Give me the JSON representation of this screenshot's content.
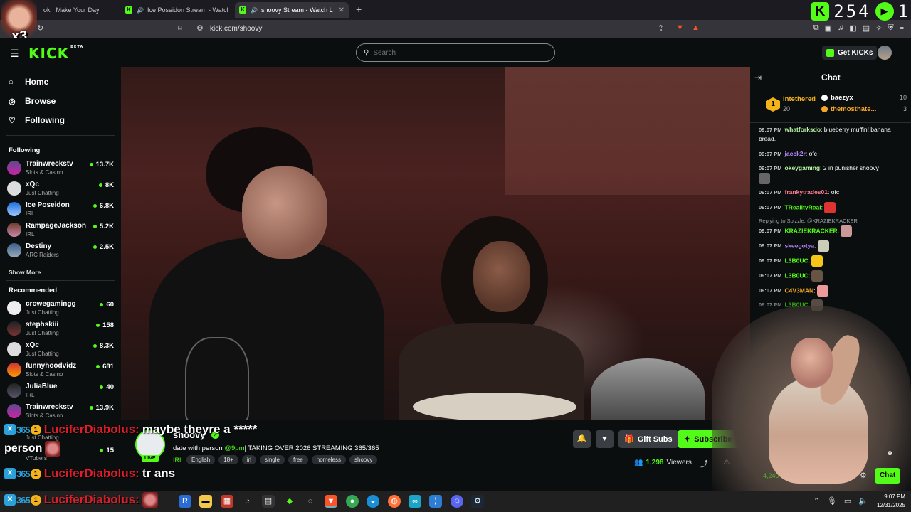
{
  "browser": {
    "tabs": [
      {
        "title": "ok · Make Your Day",
        "active": false
      },
      {
        "title": "Ice Poseidon Stream - Watch Live",
        "active": false
      },
      {
        "title": "shoovy Stream - Watch Live o",
        "active": true
      }
    ],
    "url": "kick.com/shoovy"
  },
  "overlay": {
    "counter": "254",
    "counter2": "1",
    "multiplier": "x3"
  },
  "header": {
    "logo": "KICK",
    "logo_beta": "BETA",
    "search_placeholder": "Search",
    "get_kicks": "Get KICKs"
  },
  "sidebar": {
    "nav": [
      {
        "label": "Home",
        "icon": "home-icon"
      },
      {
        "label": "Browse",
        "icon": "compass-icon"
      },
      {
        "label": "Following",
        "icon": "heart-icon"
      }
    ],
    "following_heading": "Following",
    "following": [
      {
        "name": "Trainwreckstv",
        "category": "Slots & Casino",
        "viewers": "13.7K"
      },
      {
        "name": "xQc",
        "category": "Just Chatting",
        "viewers": "8K"
      },
      {
        "name": "Ice Poseidon",
        "category": "IRL",
        "viewers": "6.8K"
      },
      {
        "name": "RampageJackson",
        "category": "IRL",
        "viewers": "5.2K"
      },
      {
        "name": "Destiny",
        "category": "ARC Raiders",
        "viewers": "2.5K"
      }
    ],
    "show_more": "Show More",
    "recommended_heading": "Recommended",
    "recommended": [
      {
        "name": "crowegamingg",
        "category": "Just Chatting",
        "viewers": "60"
      },
      {
        "name": "stephskiii",
        "category": "Just Chatting",
        "viewers": "158"
      },
      {
        "name": "xQc",
        "category": "Just Chatting",
        "viewers": "8.3K"
      },
      {
        "name": "funnyhoodvidz",
        "category": "Slots & Casino",
        "viewers": "681"
      },
      {
        "name": "JuliaBlue",
        "category": "IRL",
        "viewers": "40"
      },
      {
        "name": "Trainwreckstv",
        "category": "Slots & Casino",
        "viewers": "13.9K"
      },
      {
        "name": "",
        "category": "Just Chatting",
        "viewers": "15"
      },
      {
        "name": "",
        "category": "VTubers",
        "viewers": ""
      }
    ]
  },
  "stream": {
    "name": "shoovy",
    "live": "LIVE",
    "title_prefix": "date with person ",
    "title_highlight": "@9pm",
    "title_rest": "| TAKING OVER 2026 STREAMING 365/365",
    "category": "IRL",
    "tags": [
      "English",
      "18+",
      "irl",
      "single",
      "free",
      "homeless",
      "shoovy"
    ],
    "gift_subs": "Gift Subs",
    "subscribe": "Subscribe",
    "viewers_count": "1,298",
    "viewers_label": "Viewers"
  },
  "chat": {
    "title": "Chat",
    "leaderboard": {
      "top": {
        "rank": "1",
        "name": "Intethered",
        "value": "20"
      },
      "rows": [
        {
          "name": "baezyx",
          "value": "10",
          "color": "#ffffff"
        },
        {
          "name": "themosthate...",
          "value": "3",
          "color": "#f5a623"
        }
      ]
    },
    "messages": [
      {
        "time": "09:07 PM",
        "user": "whatforksdo",
        "color": "#b7f7a5",
        "text": "blueberry muffin! banana bread."
      },
      {
        "time": "09:07 PM",
        "user": "jacck2r",
        "color": "#b98bff",
        "text": "ofc"
      },
      {
        "time": "09:07 PM",
        "user": "okeygaming",
        "color": "#b7f7a5",
        "text": "2 in punisher shoovy"
      },
      {
        "time": "09:07 PM",
        "user": "frankytrades01",
        "color": "#ff7a93",
        "text": "ofc"
      },
      {
        "time": "09:07 PM",
        "user": "TRealityReal",
        "color": "#53fc18",
        "text": ""
      },
      {
        "time": "09:07 PM",
        "user": "KRAZIEKRACKER",
        "color": "#53fc18",
        "text": ""
      },
      {
        "time": "09:07 PM",
        "user": "skeegotya",
        "color": "#b98bff",
        "text": ""
      },
      {
        "time": "09:07 PM",
        "user": "L3B0UC",
        "color": "#53fc18",
        "text": ""
      },
      {
        "time": "09:07 PM",
        "user": "L3B0UC",
        "color": "#53fc18",
        "text": ""
      },
      {
        "time": "09:07 PM",
        "user": "C4V3MAN",
        "color": "#f5a623",
        "text": ""
      },
      {
        "time": "09:07 PM",
        "user": "L3B0UC",
        "color": "#53fc18",
        "text": ""
      }
    ],
    "reply_text": "Replying to Spizzle: @KRAZIEKRACKER",
    "chat_button": "Chat",
    "webcam_viewers": "4,240"
  },
  "overlay_chat": [
    {
      "user": "LuciferDiabolus:",
      "text": "maybe theyre a *****"
    },
    {
      "continuation": "person"
    },
    {
      "user": "LuciferDiabolus:",
      "text": "tr ans"
    },
    {
      "user": "LuciferDiabolus:",
      "text": ""
    }
  ],
  "taskbar": {
    "time": "9:07 PM",
    "date": "12/31/2025"
  }
}
